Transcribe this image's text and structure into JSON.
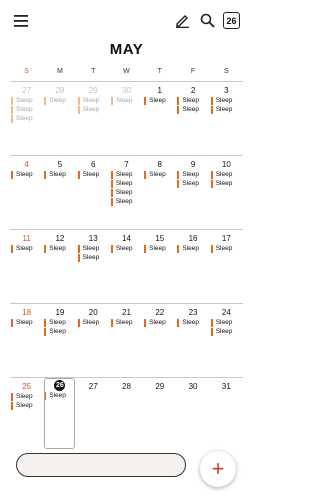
{
  "header": {
    "month": "MAY",
    "today_icon_label": "26",
    "accent": "#e46a1f",
    "sunday_color": "#d2542e"
  },
  "weekdays": [
    "S",
    "M",
    "T",
    "W",
    "T",
    "F",
    "S"
  ],
  "weeks": [
    [
      {
        "date": "27",
        "dim": true,
        "events": [
          "Sleep",
          "Sleep",
          "Sleep"
        ]
      },
      {
        "date": "28",
        "dim": true,
        "events": [
          "Sleep"
        ]
      },
      {
        "date": "29",
        "dim": true,
        "events": [
          "Sleep",
          "Sleep"
        ]
      },
      {
        "date": "30",
        "dim": true,
        "events": [
          "Sleep"
        ]
      },
      {
        "date": "1",
        "events": [
          "Sleep"
        ]
      },
      {
        "date": "2",
        "events": [
          "Sleep",
          "Sleep"
        ]
      },
      {
        "date": "3",
        "events": [
          "Sleep",
          "Sleep"
        ]
      }
    ],
    [
      {
        "date": "4",
        "events": [
          "Sleep"
        ]
      },
      {
        "date": "5",
        "events": [
          "Sleep"
        ]
      },
      {
        "date": "6",
        "events": [
          "Sleep"
        ]
      },
      {
        "date": "7",
        "events": [
          "Sleep",
          "Sleep",
          "Sleep",
          "Sleep"
        ]
      },
      {
        "date": "8",
        "events": [
          "Sleep"
        ]
      },
      {
        "date": "9",
        "events": [
          "Sleep",
          "Sleep"
        ]
      },
      {
        "date": "10",
        "events": [
          "Sleep",
          "Sleep"
        ]
      }
    ],
    [
      {
        "date": "11",
        "events": [
          "Sleep"
        ]
      },
      {
        "date": "12",
        "events": [
          "Sleep"
        ]
      },
      {
        "date": "13",
        "events": [
          "Sleep",
          "Sleep"
        ]
      },
      {
        "date": "14",
        "events": [
          "Sleep"
        ]
      },
      {
        "date": "15",
        "events": [
          "Sleep"
        ]
      },
      {
        "date": "16",
        "events": [
          "Sleep"
        ]
      },
      {
        "date": "17",
        "events": [
          "Sleep"
        ]
      }
    ],
    [
      {
        "date": "18",
        "events": [
          "Sleep"
        ]
      },
      {
        "date": "19",
        "events": [
          "Sleep",
          "Sleep"
        ]
      },
      {
        "date": "20",
        "events": [
          "Sleep"
        ]
      },
      {
        "date": "21",
        "events": [
          "Sleep"
        ]
      },
      {
        "date": "22",
        "events": [
          "Sleep"
        ]
      },
      {
        "date": "23",
        "events": [
          "Sleep"
        ]
      },
      {
        "date": "24",
        "events": [
          "Sleep",
          "Sleep"
        ]
      }
    ],
    [
      {
        "date": "25",
        "events": [
          "Sleep",
          "Sleep"
        ]
      },
      {
        "date": "26",
        "today": true,
        "events": [
          "Sleep"
        ]
      },
      {
        "date": "27",
        "events": []
      },
      {
        "date": "28",
        "events": []
      },
      {
        "date": "29",
        "events": []
      },
      {
        "date": "30",
        "events": []
      },
      {
        "date": "31",
        "events": []
      }
    ]
  ],
  "fab_label": "+"
}
